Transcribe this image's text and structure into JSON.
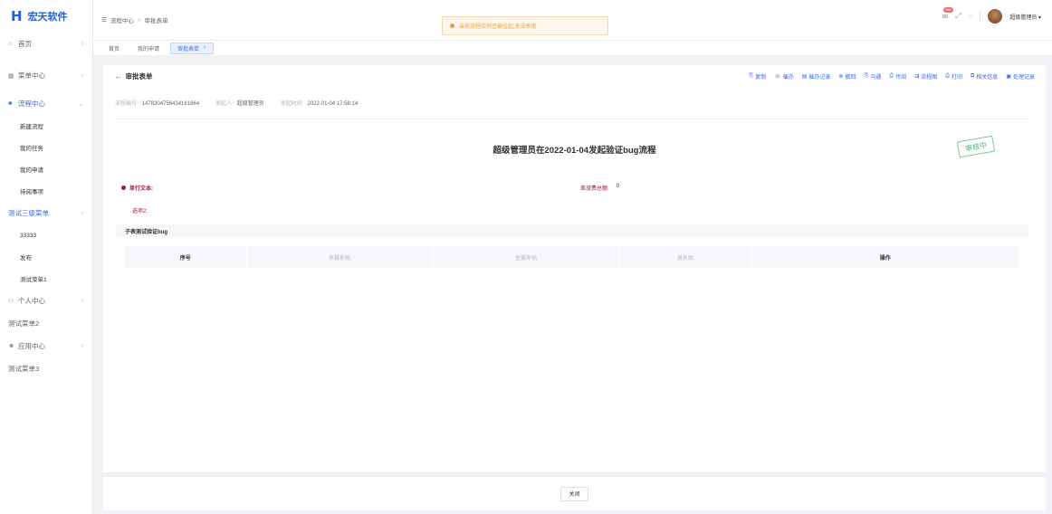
{
  "app": {
    "logo_mark": "H",
    "name": "宏天软件"
  },
  "sidebar": {
    "items": [
      {
        "label": "首页",
        "icon": "⌂"
      },
      {
        "label": "菜单中心",
        "icon": "▦"
      },
      {
        "label": "流程中心",
        "icon": "♣"
      },
      {
        "label": "新建流程"
      },
      {
        "label": "我的任务"
      },
      {
        "label": "我的申请"
      },
      {
        "label": "待阅事项"
      },
      {
        "label": "测试三级菜单"
      },
      {
        "label": "33333"
      },
      {
        "label": "发布"
      },
      {
        "label": "测试菜单1"
      },
      {
        "label": "个人中心",
        "icon": "⚇"
      },
      {
        "label": "测试菜单2"
      },
      {
        "label": "应用中心",
        "icon": "☻"
      },
      {
        "label": "测试菜单3"
      }
    ]
  },
  "header": {
    "breadcrumb": [
      "流程中心",
      "审批表单"
    ],
    "breadcrumb_icon": "☰",
    "sep": ">",
    "toast": "当前流程实例已被挂起,无法审批",
    "badge": "99+",
    "user": "超级管理员 ▾"
  },
  "tabs": [
    {
      "label": "首页"
    },
    {
      "label": "我的申请"
    },
    {
      "label": "审批表单",
      "close": "×"
    }
  ],
  "card": {
    "back": "←",
    "title": "审批表单",
    "actions": [
      {
        "icon": "⎘",
        "label": "复制"
      },
      {
        "icon": "☏",
        "label": "催办"
      },
      {
        "icon": "▤",
        "label": "催办记录"
      },
      {
        "icon": "⊗",
        "label": "撤回"
      },
      {
        "icon": "⎘",
        "label": "沟通"
      },
      {
        "icon": "⎙",
        "label": "传阅"
      },
      {
        "icon": "⇶",
        "label": "流程图"
      },
      {
        "icon": "⎙",
        "label": "打印"
      },
      {
        "icon": "⧉",
        "label": "相关信息"
      },
      {
        "icon": "▣",
        "label": "处理记录"
      }
    ],
    "meta": {
      "no_label": "流程编号:",
      "no_value": "1478304756434161664",
      "starter_label": "发起人:",
      "starter_value": "超级管理员",
      "time_label": "发起时间:",
      "time_value": "2022-01-04 17:58:14"
    },
    "form_title": "超级管理员在2022-01-04发起验证bug流程",
    "stamp": "审核中",
    "field_left": "单行文本:",
    "field_right_label": "差旅费总额:",
    "field_right_value": "0",
    "option": "选项2:",
    "sub_title": "子表测试验证bug",
    "table_headers": [
      "序号",
      "早餐补贴",
      "住宿补贴",
      "总补贴",
      "操作"
    ]
  },
  "footer": {
    "close_label": "关闭"
  },
  "colors": {
    "primary": "#3a6be6",
    "warning": "#e6a23c",
    "required": "#a0154b",
    "success": "#5db37e"
  }
}
